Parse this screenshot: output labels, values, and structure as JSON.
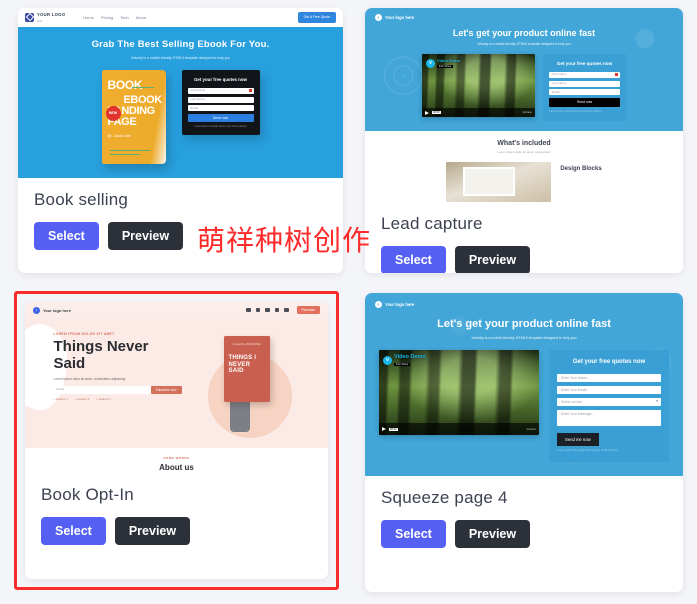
{
  "page": {
    "background": "#f4f5f9",
    "watermark": "萌祥种树创作",
    "watermark_color": "#ff2a2a",
    "accent_select": "#5560f3",
    "accent_preview": "#2b3039",
    "selection_border": "#fb2c2c"
  },
  "buttons": {
    "select": "Select",
    "preview": "Preview"
  },
  "templates": [
    {
      "id": "book-selling",
      "title": "Book selling",
      "selected": false,
      "preview": {
        "kind": "book-selling",
        "logo_text": "YOUR LOGO",
        "logo_sub": "here",
        "nav": [
          "Home",
          "Pricing",
          "Tech",
          "About"
        ],
        "nav_cta": "Get A Free Quote",
        "headline": "Grab The Best Selling Ebook For You.",
        "subhead": "Velocity is a mobile-friendly HTML5 template designed to help you",
        "book": {
          "line1": "BOOK",
          "badge": "NEW",
          "line2": "EBOOK",
          "line3": "LANDING",
          "line4": "PAGE",
          "author": "By - Jason Doe"
        },
        "form": {
          "title": "Get your free quotes now",
          "fields": [
            "First Name",
            "Last Name",
            "Email"
          ],
          "button": "Send now",
          "note": "Lorem ipsum is simply dummy text of the printing"
        }
      }
    },
    {
      "id": "lead-capture",
      "title": "Lead capture",
      "selected": false,
      "preview": {
        "kind": "lead-capture",
        "logo_text": "Your logo here",
        "headline": "Let's get your product online fast",
        "subhead": "Velocity is a mobile-friendly HTML5 template designed to help you",
        "video": {
          "label": "Video Demo",
          "brand": "from Vimeo",
          "time": "00:00",
          "provider": "vimeo"
        },
        "form": {
          "title": "Get your free quotes now",
          "fields": [
            "First Name",
            "Last Name",
            "Email"
          ],
          "button": "Send now",
          "note": "Lorem ipsum is simply dummy text of the printing"
        },
        "section": {
          "title": "What's included",
          "subtitle": "Lorem ipsum dolor sit amet, consectetur",
          "card_title": "Design Blocks"
        }
      }
    },
    {
      "id": "book-opt-in",
      "title": "Book Opt-In",
      "selected": true,
      "preview": {
        "kind": "book-opt-in",
        "logo_text": "Your logo here",
        "social_icons": [
          "facebook-icon",
          "twitter-icon",
          "instagram-icon",
          "youtube-icon",
          "dribbble-icon"
        ],
        "buy_button": "Purchase",
        "kicker": "LOREM IPSUM DOLOR SIT AMET",
        "headline": "Things Never Said",
        "subhead": "Lorem ipsum dolor sit amet, consectetur adipiscing",
        "email_placeholder": "Email",
        "subscribe_button": "Subscribe now",
        "features": [
          "+ Feature 1",
          "+ Feature 2",
          "+ Feature 3"
        ],
        "book_cover": {
          "author": "A novel by JASON DOE",
          "title": "THINGS I NEVER SAID"
        },
        "section": {
          "kicker": "SOME WORDS",
          "title": "About us"
        }
      }
    },
    {
      "id": "squeeze-page-4",
      "title": "Squeeze page 4",
      "selected": false,
      "preview": {
        "kind": "squeeze-page",
        "logo_text": "Your logo here",
        "headline": "Let's get your product online fast",
        "subhead": "Velocity is a mobile-friendly HTML5 template designed to help you",
        "video": {
          "label": "Video Demo",
          "brand": "from Vimeo",
          "time": "00:00",
          "provider": "vimeo"
        },
        "form": {
          "title": "Get your free quotes now",
          "name_placeholder": "Enter Your Name...",
          "email_placeholder": "Enter Your Email...",
          "select_placeholder": "Select service",
          "message_placeholder": "Enter Your Message...",
          "button": "Send me now",
          "note": "Lorem Ipsum is simply dummy text of the printing"
        }
      }
    }
  ]
}
